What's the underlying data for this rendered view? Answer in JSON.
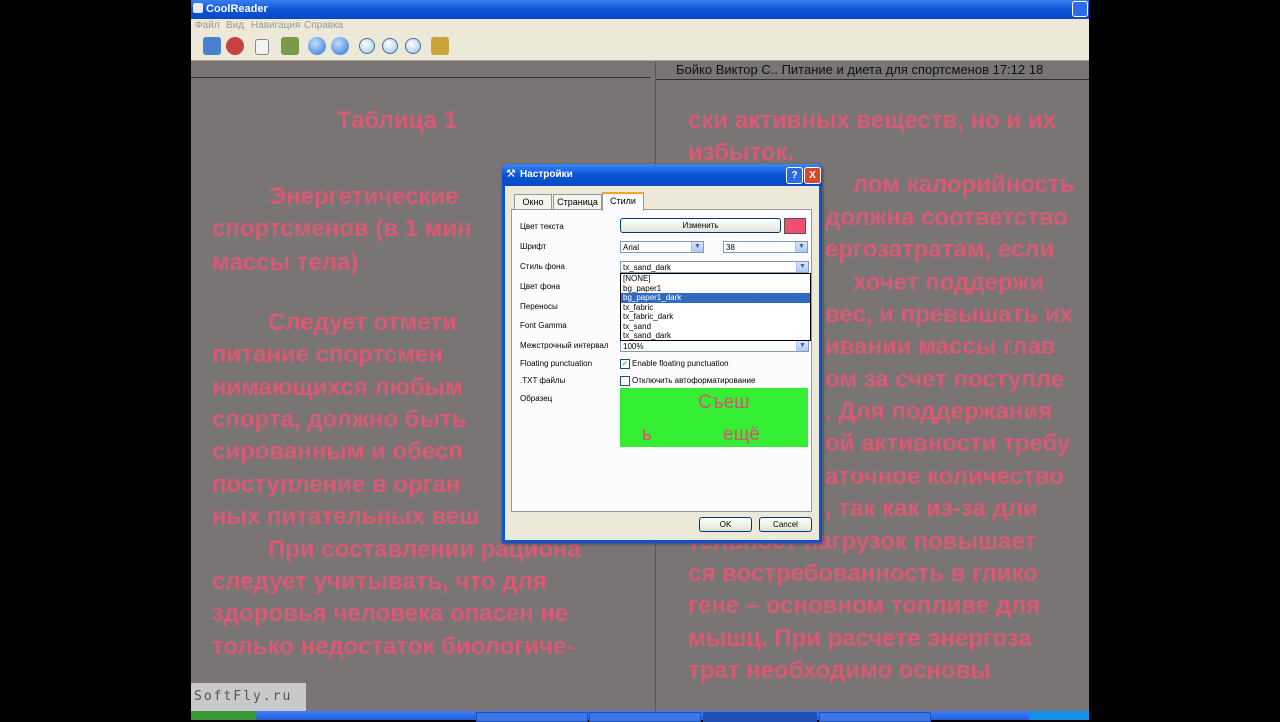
{
  "app": {
    "title": "CoolReader"
  },
  "menu": [
    "Файл",
    "Вид",
    "Навигация",
    "Справка"
  ],
  "reader": {
    "header_right": "Бойко Виктор С.. Питание и диета для спортсменов     17:12   18",
    "left_lines": [
      "Таблица 1",
      "Энергетические",
      "спортсменов (в 1 мин",
      "массы тела)",
      "Следует  отмети",
      "питание  спортсмен",
      "нимающихся  любым",
      "спорта, должно быть",
      "сированным и обесп",
      "поступление в орган",
      "ных питательных веш",
      "При составлении рациона",
      "следует учитывать, что для",
      "здоровья человека опасен не",
      "только недостаток биологиче-"
    ],
    "right_lines": [
      "ски активных веществ, но и их",
      "избыток.",
      "лом   калорийность",
      "должна соответство",
      "ергозатратам,   если",
      "хочет  поддержи",
      "вес, и превышать их",
      "ивании массы глав",
      "ом за счет поступле",
      ". Для поддержания",
      "ой активности требу",
      "аточное количество",
      ", так как из-за дли",
      "тельност нагрузок повышает",
      "ся востребованность в глико",
      "гене – основном топливе для",
      "мышц. При расчете энергоза",
      "трат   необходимо   основы"
    ]
  },
  "watermark": "SoftFly.ru",
  "dialog": {
    "title": "Настройки",
    "help": "?",
    "close": "X",
    "tabs": [
      "Окно",
      "Страница",
      "Стили"
    ],
    "active_tab": "Стили",
    "text_color_label": "Цвет текста",
    "change_button": "Изменить",
    "text_color": "#f05070",
    "font_label": "Шрифт",
    "font_value": "Arial",
    "font_size": "38",
    "bg_style_label": "Стиль фона",
    "bg_style_value": "tx_sand_dark",
    "bg_color_label": "Цвет фона",
    "hyphen_label": "Переносы",
    "gamma_label": "Font Gamma",
    "line_spacing_label": "Межстрочный интервал",
    "line_spacing_value": "100%",
    "floating_label": "Floating punctuation",
    "floating_check": "Enable floating punctuation",
    "floating_checked": true,
    "txt_label": ".TXT файлы",
    "txt_check": "Отключить автоформатирование",
    "txt_checked": false,
    "sample_label": "Образец",
    "sample_word1": "Съеш",
    "sample_word2": "ь",
    "sample_word3": "ещё",
    "ok": "OK",
    "cancel": "Cancel",
    "bg_options": [
      "[NONE]",
      "bg_paper1",
      "bg_paper1_dark",
      "tx_fabric",
      "tx_fabric_dark",
      "tx_sand",
      "tx_sand_dark"
    ],
    "selected_option": "bg_paper1_dark"
  }
}
